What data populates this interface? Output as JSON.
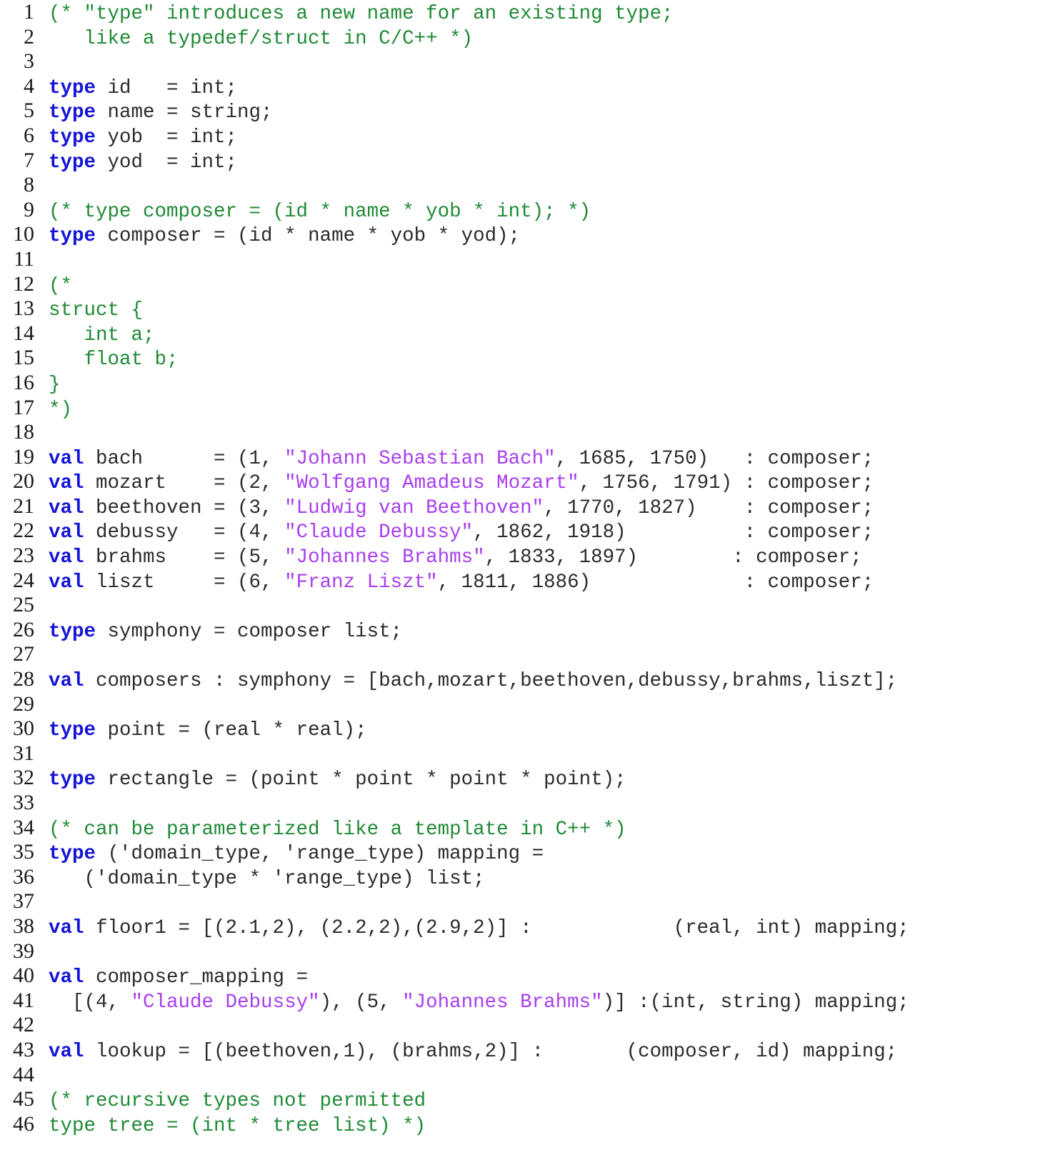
{
  "document": {
    "kind": "source-code-listing",
    "language": "Standard ML",
    "total_lines": 46,
    "colors": {
      "keyword": "#1414d6",
      "comment": "#1f8a35",
      "string": "#a83ef0",
      "plain": "#2b2b2b",
      "line_number": "#1a1a1a",
      "background": "#ffffff"
    }
  },
  "lines": [
    {
      "number": "1",
      "tokens": [
        {
          "t": "comment",
          "s": "(* \"type\" introduces a new name for an existing type;"
        }
      ]
    },
    {
      "number": "2",
      "tokens": [
        {
          "t": "comment",
          "s": "   like a typedef/struct in C/C++ *)"
        }
      ]
    },
    {
      "number": "3",
      "tokens": []
    },
    {
      "number": "4",
      "tokens": [
        {
          "t": "keyword",
          "s": "type"
        },
        {
          "t": "plain",
          "s": " id   = int;"
        }
      ]
    },
    {
      "number": "5",
      "tokens": [
        {
          "t": "keyword",
          "s": "type"
        },
        {
          "t": "plain",
          "s": " name = string;"
        }
      ]
    },
    {
      "number": "6",
      "tokens": [
        {
          "t": "keyword",
          "s": "type"
        },
        {
          "t": "plain",
          "s": " yob  = int;"
        }
      ]
    },
    {
      "number": "7",
      "tokens": [
        {
          "t": "keyword",
          "s": "type"
        },
        {
          "t": "plain",
          "s": " yod  = int;"
        }
      ]
    },
    {
      "number": "8",
      "tokens": []
    },
    {
      "number": "9",
      "tokens": [
        {
          "t": "comment",
          "s": "(* type composer = (id * name * yob * int); *)"
        }
      ]
    },
    {
      "number": "10",
      "tokens": [
        {
          "t": "keyword",
          "s": "type"
        },
        {
          "t": "plain",
          "s": " composer = (id * name * yob * yod);"
        }
      ]
    },
    {
      "number": "11",
      "tokens": []
    },
    {
      "number": "12",
      "tokens": [
        {
          "t": "comment",
          "s": "(*"
        }
      ]
    },
    {
      "number": "13",
      "tokens": [
        {
          "t": "comment",
          "s": "struct {"
        }
      ]
    },
    {
      "number": "14",
      "tokens": [
        {
          "t": "comment",
          "s": "   int a;"
        }
      ]
    },
    {
      "number": "15",
      "tokens": [
        {
          "t": "comment",
          "s": "   float b;"
        }
      ]
    },
    {
      "number": "16",
      "tokens": [
        {
          "t": "comment",
          "s": "}"
        }
      ]
    },
    {
      "number": "17",
      "tokens": [
        {
          "t": "comment",
          "s": "*)"
        }
      ]
    },
    {
      "number": "18",
      "tokens": []
    },
    {
      "number": "19",
      "tokens": [
        {
          "t": "keyword",
          "s": "val"
        },
        {
          "t": "plain",
          "s": " bach      = (1, "
        },
        {
          "t": "string",
          "s": "\"Johann Sebastian Bach\""
        },
        {
          "t": "plain",
          "s": ", 1685, 1750)   : composer;"
        }
      ]
    },
    {
      "number": "20",
      "tokens": [
        {
          "t": "keyword",
          "s": "val"
        },
        {
          "t": "plain",
          "s": " mozart    = (2, "
        },
        {
          "t": "string",
          "s": "\"Wolfgang Amadeus Mozart\""
        },
        {
          "t": "plain",
          "s": ", 1756, 1791) : composer;"
        }
      ]
    },
    {
      "number": "21",
      "tokens": [
        {
          "t": "keyword",
          "s": "val"
        },
        {
          "t": "plain",
          "s": " beethoven = (3, "
        },
        {
          "t": "string",
          "s": "\"Ludwig van Beethoven\""
        },
        {
          "t": "plain",
          "s": ", 1770, 1827)    : composer;"
        }
      ]
    },
    {
      "number": "22",
      "tokens": [
        {
          "t": "keyword",
          "s": "val"
        },
        {
          "t": "plain",
          "s": " debussy   = (4, "
        },
        {
          "t": "string",
          "s": "\"Claude Debussy\""
        },
        {
          "t": "plain",
          "s": ", 1862, 1918)          : composer;"
        }
      ]
    },
    {
      "number": "23",
      "tokens": [
        {
          "t": "keyword",
          "s": "val"
        },
        {
          "t": "plain",
          "s": " brahms    = (5, "
        },
        {
          "t": "string",
          "s": "\"Johannes Brahms\""
        },
        {
          "t": "plain",
          "s": ", 1833, 1897)        : composer;"
        }
      ]
    },
    {
      "number": "24",
      "tokens": [
        {
          "t": "keyword",
          "s": "val"
        },
        {
          "t": "plain",
          "s": " liszt     = (6, "
        },
        {
          "t": "string",
          "s": "\"Franz Liszt\""
        },
        {
          "t": "plain",
          "s": ", 1811, 1886)             : composer;"
        }
      ]
    },
    {
      "number": "25",
      "tokens": []
    },
    {
      "number": "26",
      "tokens": [
        {
          "t": "keyword",
          "s": "type"
        },
        {
          "t": "plain",
          "s": " symphony = composer list;"
        }
      ]
    },
    {
      "number": "27",
      "tokens": []
    },
    {
      "number": "28",
      "tokens": [
        {
          "t": "keyword",
          "s": "val"
        },
        {
          "t": "plain",
          "s": " composers : symphony = [bach,mozart,beethoven,debussy,brahms,liszt];"
        }
      ]
    },
    {
      "number": "29",
      "tokens": []
    },
    {
      "number": "30",
      "tokens": [
        {
          "t": "keyword",
          "s": "type"
        },
        {
          "t": "plain",
          "s": " point = (real * real);"
        }
      ]
    },
    {
      "number": "31",
      "tokens": []
    },
    {
      "number": "32",
      "tokens": [
        {
          "t": "keyword",
          "s": "type"
        },
        {
          "t": "plain",
          "s": " rectangle = (point * point * point * point);"
        }
      ]
    },
    {
      "number": "33",
      "tokens": []
    },
    {
      "number": "34",
      "tokens": [
        {
          "t": "comment",
          "s": "(* can be parameterized like a template in C++ *)"
        }
      ]
    },
    {
      "number": "35",
      "tokens": [
        {
          "t": "keyword",
          "s": "type"
        },
        {
          "t": "plain",
          "s": " ('domain_type, 'range_type) mapping ="
        }
      ]
    },
    {
      "number": "36",
      "tokens": [
        {
          "t": "plain",
          "s": "   ('domain_type * 'range_type) list;"
        }
      ]
    },
    {
      "number": "37",
      "tokens": []
    },
    {
      "number": "38",
      "tokens": [
        {
          "t": "keyword",
          "s": "val"
        },
        {
          "t": "plain",
          "s": " floor1 = [(2.1,2), (2.2,2),(2.9,2)] :            (real, int) mapping;"
        }
      ]
    },
    {
      "number": "39",
      "tokens": []
    },
    {
      "number": "40",
      "tokens": [
        {
          "t": "keyword",
          "s": "val"
        },
        {
          "t": "plain",
          "s": " composer_mapping ="
        }
      ]
    },
    {
      "number": "41",
      "tokens": [
        {
          "t": "plain",
          "s": "  [(4, "
        },
        {
          "t": "string",
          "s": "\"Claude Debussy\""
        },
        {
          "t": "plain",
          "s": "), (5, "
        },
        {
          "t": "string",
          "s": "\"Johannes Brahms\""
        },
        {
          "t": "plain",
          "s": ")] :(int, string) mapping;"
        }
      ]
    },
    {
      "number": "42",
      "tokens": []
    },
    {
      "number": "43",
      "tokens": [
        {
          "t": "keyword",
          "s": "val"
        },
        {
          "t": "plain",
          "s": " lookup = [(beethoven,1), (brahms,2)] :       (composer, id) mapping;"
        }
      ]
    },
    {
      "number": "44",
      "tokens": []
    },
    {
      "number": "45",
      "tokens": [
        {
          "t": "comment",
          "s": "(* recursive types not permitted"
        }
      ]
    },
    {
      "number": "46",
      "tokens": [
        {
          "t": "comment",
          "s": "type tree = (int * tree list) *)"
        }
      ]
    }
  ]
}
